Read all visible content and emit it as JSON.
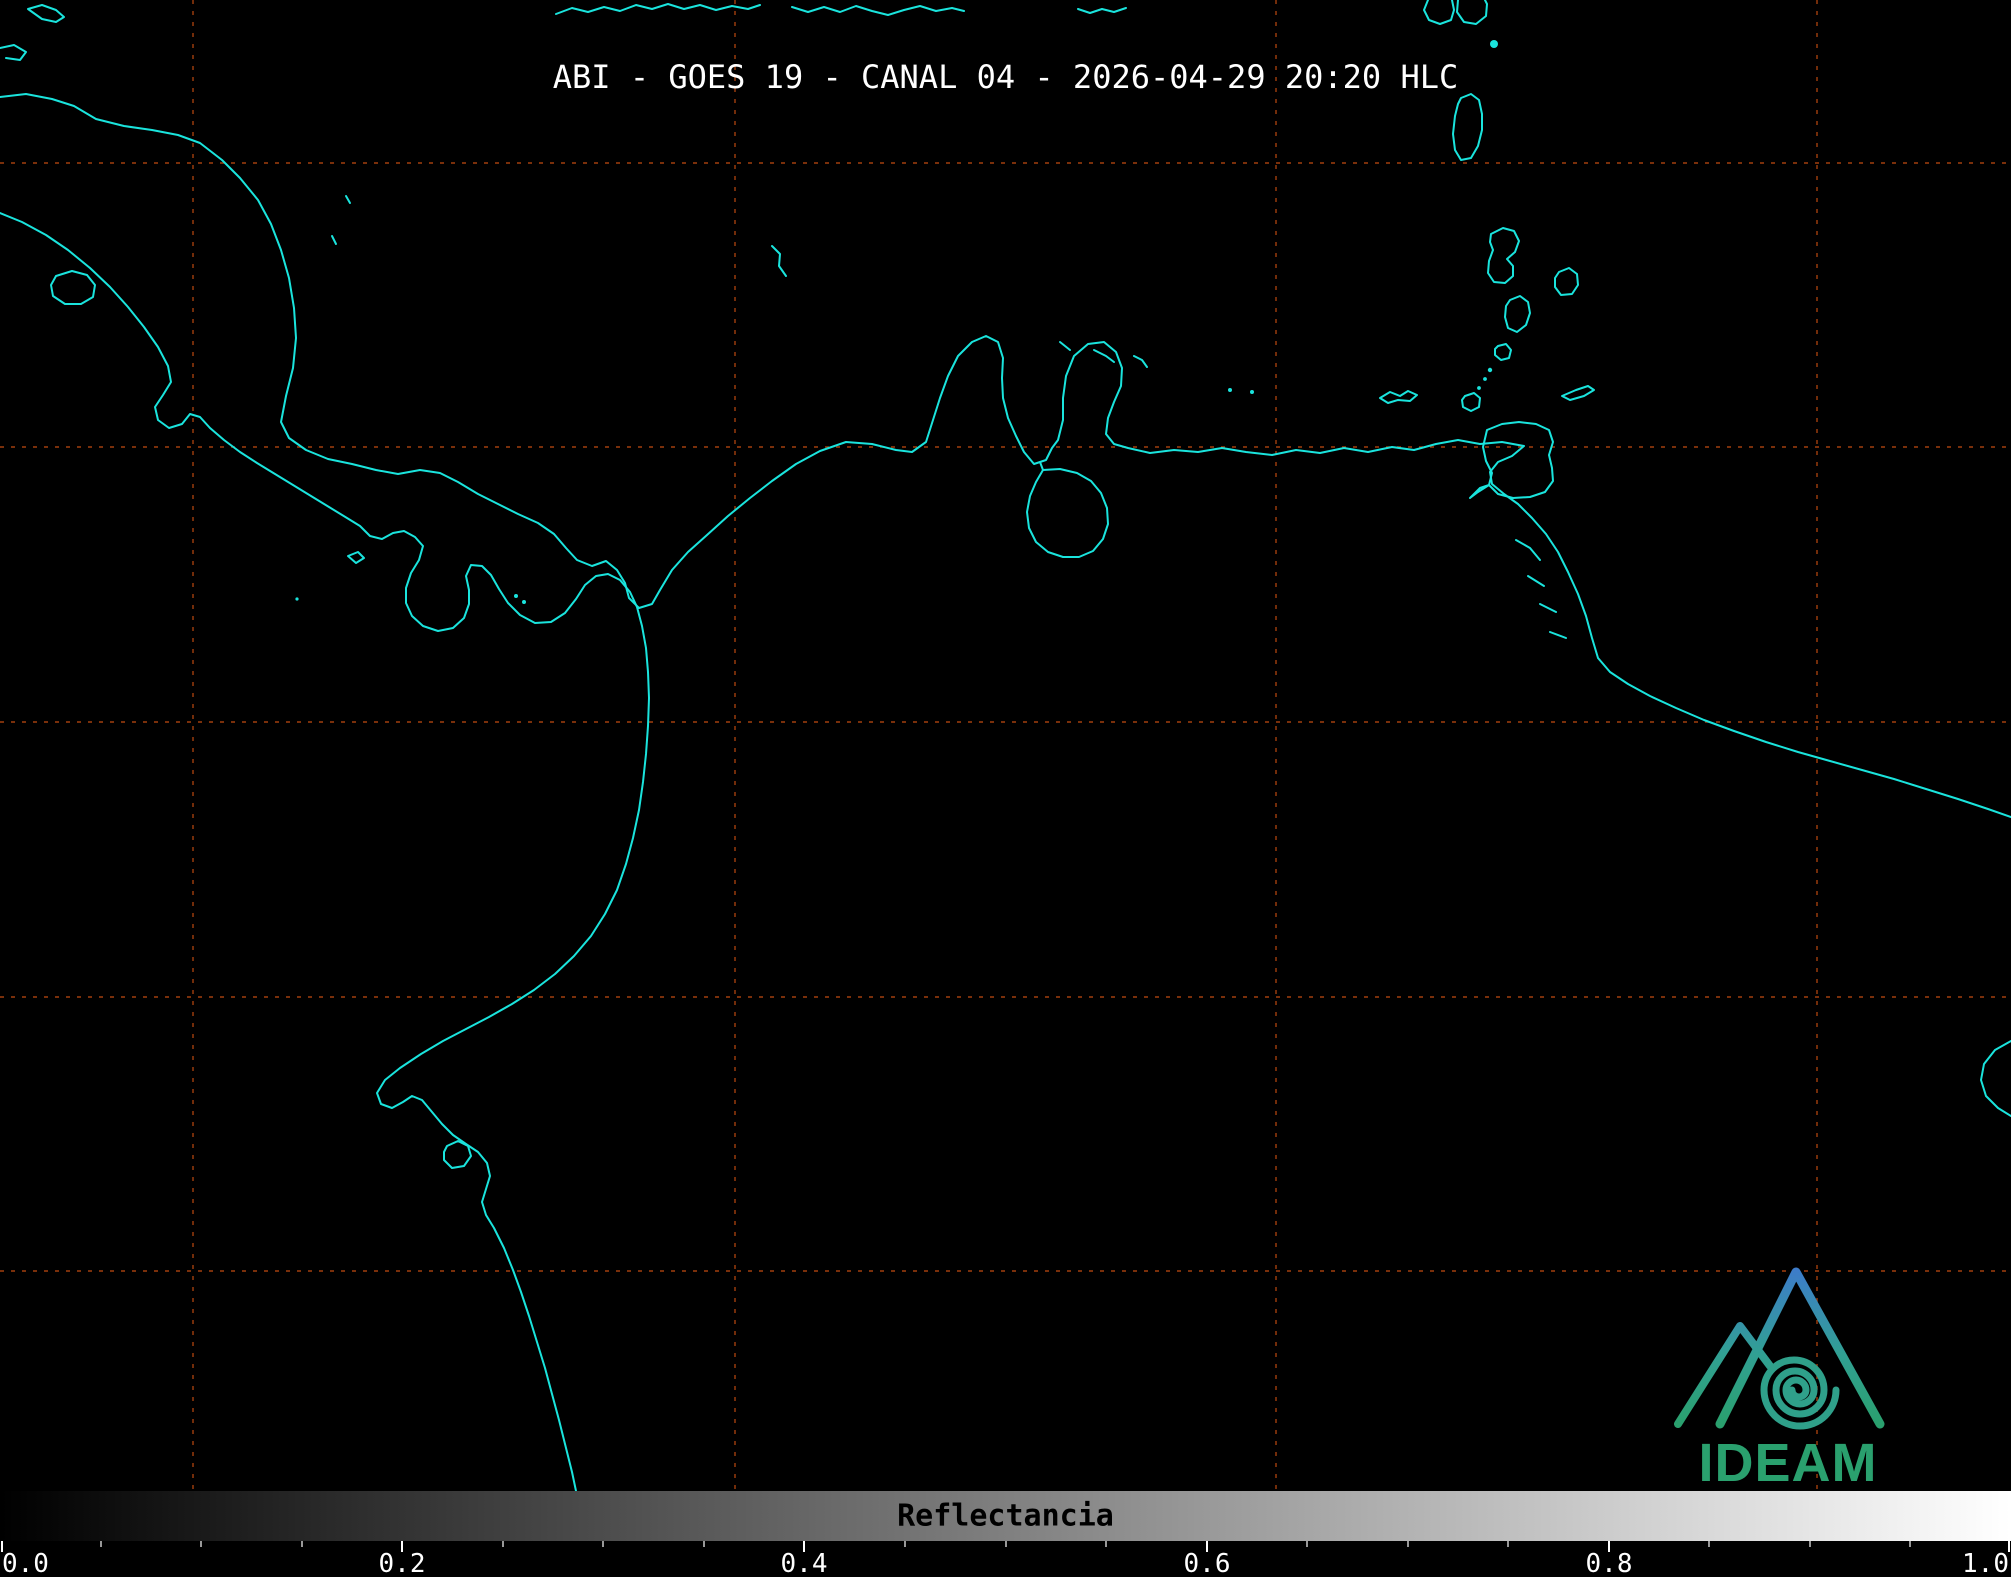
{
  "header": {
    "title": "ABI - GOES 19 - CANAL 04 - 2026-04-29 20:20 HLC"
  },
  "map": {
    "background_color": "#000000",
    "coastline_color": "#1ae4dd",
    "grid_color": "#c04a10"
  },
  "colorbar": {
    "label": "Reflectancia",
    "min": 0.0,
    "max": 1.0,
    "tick_labels": [
      "0.0",
      "0.2",
      "0.4",
      "0.6",
      "0.8",
      "1.0"
    ],
    "gradient_start": "#000000",
    "gradient_end": "#ffffff"
  },
  "logo": {
    "text": "IDEAM",
    "primary_green": "#2aa06e",
    "primary_blue": "#3d7cc9",
    "swirl_color": "#2fa08a"
  }
}
